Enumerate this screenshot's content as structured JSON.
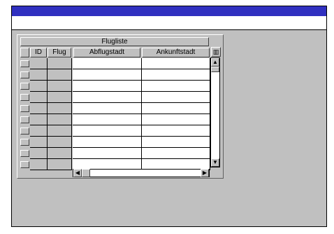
{
  "grid": {
    "caption": "Flugliste",
    "columns": [
      "ID",
      "Flug",
      "Abflugstadt",
      "Ankunftstadt"
    ]
  },
  "icons": {
    "corner": "table-columns-icon",
    "scroll_up": "arrow-up-icon",
    "scroll_down": "arrow-down-icon",
    "scroll_left": "arrow-left-icon",
    "scroll_right": "arrow-right-icon"
  },
  "colors": {
    "titlebar": "#3030c0",
    "window_bg": "#c0c0c0",
    "cell_bg": "#ffffff"
  }
}
